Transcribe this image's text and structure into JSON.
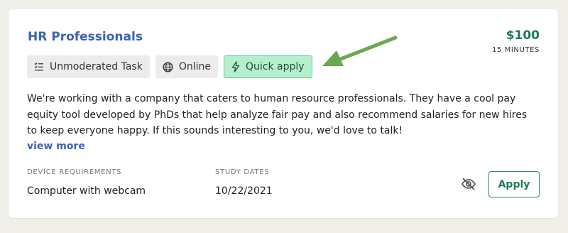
{
  "study": {
    "title": "HR Professionals",
    "price": "$100",
    "duration": "15 MINUTES",
    "tags": [
      {
        "label": "Unmoderated Task",
        "icon": "checklist-icon"
      },
      {
        "label": "Online",
        "icon": "globe-icon"
      },
      {
        "label": "Quick apply",
        "icon": "lightning-icon"
      }
    ],
    "description": "We're working with a company that caters to human resource professionals. They have a cool pay equity tool developed by PhDs that help analyze fair pay and also recommend salaries for new hires to keep everyone happy. If this sounds interesting to you, we'd love to talk!",
    "view_more_label": "view more",
    "device_requirements_label": "DEVICE REQUIREMENTS",
    "device_requirements_value": "Computer with webcam",
    "study_dates_label": "STUDY DATES",
    "study_dates_value": "10/22/2021",
    "apply_label": "Apply",
    "hide_icon": "eye-off-icon"
  },
  "colors": {
    "background": "#f1efea",
    "card": "#ffffff",
    "title": "#3b63b3",
    "price": "#1d7a52",
    "quick_apply_bg": "#b5f0cd",
    "quick_apply_border": "#5fd292",
    "annotation_arrow": "#6aa84f"
  }
}
